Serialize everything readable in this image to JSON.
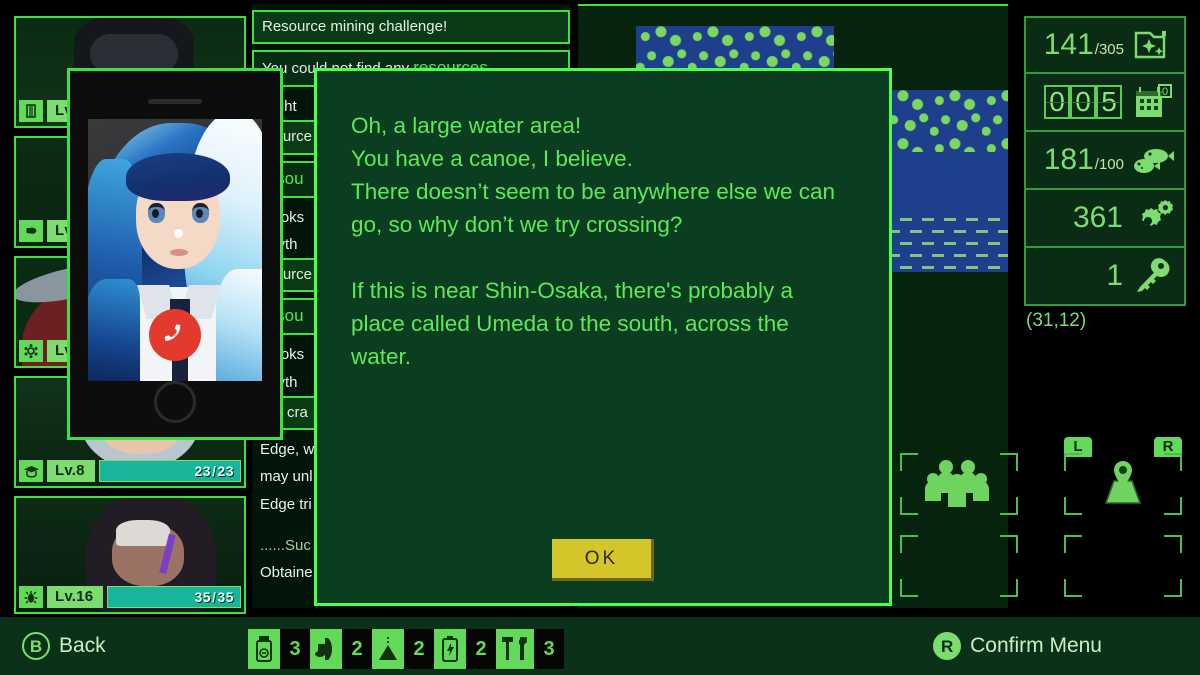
{
  "dialog": {
    "text": "Oh, a large water area!\nYou have a canoe, I believe.\nThere doesn’t seem to be anywhere else we can\ngo, so why don’t we try crossing?\n\nIf this is near Shin-Osaka, there's probably a\nplace called Umeda to the south, across the\nwater.",
    "ok_label": "OK"
  },
  "phone": {
    "caller_icon": "hangup-icon"
  },
  "party": [
    {
      "class_icon": "vest-icon",
      "level": "Lv.",
      "hp_current": "",
      "hp_max": "",
      "hp_pct": 0,
      "show_hp": false
    },
    {
      "class_icon": "muscle-icon",
      "level": "Lv.",
      "hp_current": "",
      "hp_max": "",
      "hp_pct": 0,
      "show_hp": false
    },
    {
      "class_icon": "flower-icon",
      "level": "Lv.",
      "hp_current": "",
      "hp_max": "",
      "hp_pct": 0,
      "show_hp": false
    },
    {
      "class_icon": "graduation-icon",
      "level": "Lv.8",
      "hp_current": "23",
      "hp_max": "23",
      "hp_pct": 100,
      "show_hp": true
    },
    {
      "class_icon": "bug-icon",
      "level": "Lv.16",
      "hp_current": "35",
      "hp_max": "35",
      "hp_pct": 100,
      "show_hp": true
    }
  ],
  "log": {
    "entries": [
      {
        "style": "head",
        "text": "Resource mining challenge!"
      },
      {
        "style": "entry",
        "text": "You could not find any ",
        "highlight": "resources..."
      },
      {
        "style": "plain",
        "text": "...ight"
      },
      {
        "style": "head",
        "text": "...ource"
      },
      {
        "style": "entry",
        "text": "",
        "highlight": "...sou"
      },
      {
        "style": "plain",
        "text": "...ooks"
      },
      {
        "style": "plain",
        "text": "...ryth"
      },
      {
        "style": "head",
        "text": "...ource"
      },
      {
        "style": "entry",
        "text": "",
        "highlight": "...sou"
      },
      {
        "style": "plain",
        "text": "...ooks"
      },
      {
        "style": "plain",
        "text": "...ryth"
      },
      {
        "style": "head",
        "text": "...e cra"
      },
      {
        "style": "plain",
        "text": "Edge, wh"
      },
      {
        "style": "plain",
        "text": "may unl"
      },
      {
        "style": "plain",
        "text": "Edge tri"
      },
      {
        "style": "dim",
        "text": "......Suc"
      },
      {
        "style": "plain",
        "text": "Obtaine"
      }
    ]
  },
  "stats": {
    "rows": [
      {
        "icon": "sparkle-folder-icon",
        "value": "141",
        "denominator": "/305",
        "type": "fraction"
      },
      {
        "icon": "calendar-icon",
        "digits": [
          "0",
          "0",
          "5"
        ],
        "type": "odometer",
        "badge": "0"
      },
      {
        "icon": "fish-food-icon",
        "value": "181",
        "denominator": "/100",
        "type": "fraction"
      },
      {
        "icon": "gears-icon",
        "value": "361",
        "denominator": "",
        "type": "plain"
      },
      {
        "icon": "key-icon",
        "value": "1",
        "denominator": "",
        "type": "plain"
      }
    ],
    "coords": "(31,12)"
  },
  "menu": {
    "party_icon": "people-group-icon",
    "map_icon": "map-pin-icon",
    "left_bumper": "L",
    "right_bumper": "R"
  },
  "bottom_bar": {
    "back_button": "B",
    "back_label": "Back",
    "confirm_button": "R",
    "confirm_label": "Confirm Menu",
    "items": [
      {
        "icon": "medicine-bottle-icon",
        "count": "3"
      },
      {
        "icon": "bullet-icon",
        "count": "2"
      },
      {
        "icon": "net-trap-icon",
        "count": "2"
      },
      {
        "icon": "battery-icon",
        "count": "2"
      },
      {
        "icon": "tools-icon",
        "count": "3"
      }
    ]
  },
  "colors": {
    "bright_green": "#4dff4d",
    "panel_green": "#0b2c14",
    "dialog_bg": "#0b3d20",
    "text_green": "#5ee85a",
    "hp_teal": "#18b59a",
    "ok_yellow": "#d4c52b",
    "water_blue": "#1e3f8c",
    "foliage_green": "#7ad85f"
  }
}
